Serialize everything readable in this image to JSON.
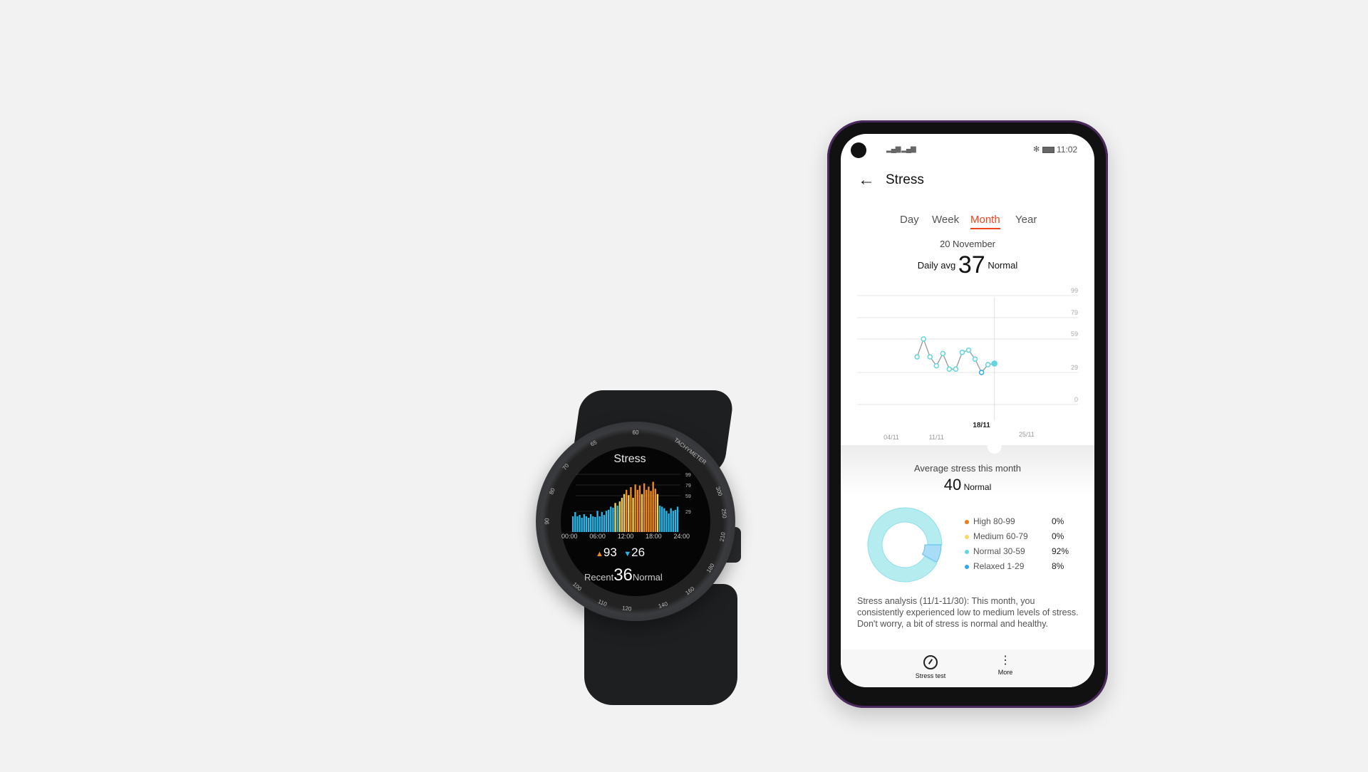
{
  "watch": {
    "title": "Stress",
    "ticks": [
      "99",
      "79",
      "59",
      "29"
    ],
    "time_labels": [
      "00:00",
      "06:00",
      "12:00",
      "18:00",
      "24:00"
    ],
    "max_value": "93",
    "min_value": "26",
    "recent_label": "Recent",
    "recent_value": "36",
    "recent_status": "Normal",
    "bezel_labels": [
      "60",
      "TACHYMETER",
      "300",
      "250",
      "210",
      "180",
      "160",
      "140",
      "120",
      "110",
      "100",
      "90",
      "80",
      "70",
      "65"
    ],
    "colors": {
      "relaxed": "#29b6e8",
      "normal": "#f5d45a",
      "high": "#f08a1c"
    }
  },
  "phone": {
    "status": {
      "signal": "signal-icon",
      "bluetooth": "bluetooth-icon",
      "battery": "battery-icon",
      "time": "11:02"
    },
    "title": "Stress",
    "tabs": [
      {
        "label": "Day"
      },
      {
        "label": "Week"
      },
      {
        "label": "Month",
        "active": true
      },
      {
        "label": "Year"
      }
    ],
    "accent": "#f0421c",
    "date": "20 November",
    "daily_avg_label": "Daily avg",
    "daily_avg_value": "37",
    "daily_avg_status": "Normal",
    "month_avg_label": "Average stress this month",
    "month_avg_value": "40",
    "month_avg_status": "Normal",
    "legend": [
      {
        "label": "High 80-99",
        "pct": "0%",
        "color": "#ef7a1a"
      },
      {
        "label": "Medium 60-79",
        "pct": "0%",
        "color": "#fbd86a"
      },
      {
        "label": "Normal 30-59",
        "pct": "92%",
        "color": "#5fd6e0"
      },
      {
        "label": "Relaxed 1-29",
        "pct": "8%",
        "color": "#2ea8ef"
      }
    ],
    "analysis": "Stress analysis (11/1-11/30): This month, you consistently experienced low to medium levels of stress. Don't worry, a bit of stress is normal and healthy.",
    "bottom": [
      {
        "label": "Stress test",
        "icon": "gauge-icon"
      },
      {
        "label": "More",
        "icon": "more-vertical-icon"
      }
    ]
  },
  "chart_data": [
    {
      "type": "line",
      "x_labels": [
        "04/11",
        "11/11",
        "18/11",
        "25/11"
      ],
      "selected_x": "18/11",
      "y_ticks": [
        99,
        79,
        59,
        29,
        0
      ],
      "x": [
        "08/11",
        "09/11",
        "10/11",
        "11/11",
        "12/11",
        "13/11",
        "14/11",
        "15/11",
        "16/11",
        "17/11",
        "18/11",
        "19/11",
        "20/11"
      ],
      "days": [
        8,
        9,
        10,
        11,
        12,
        13,
        14,
        15,
        16,
        17,
        18,
        19,
        20
      ],
      "values": [
        43,
        59,
        43,
        35,
        46,
        32,
        32,
        47,
        49,
        41,
        29,
        36,
        37
      ],
      "grid": true
    },
    {
      "type": "bar",
      "x_labels": [
        "00:00",
        "06:00",
        "12:00",
        "18:00",
        "24:00"
      ],
      "y_ticks": [
        99,
        79,
        59,
        29
      ],
      "values": [
        22,
        28,
        22,
        24,
        20,
        25,
        22,
        20,
        25,
        22,
        21,
        30,
        22,
        28,
        24,
        30,
        32,
        38,
        36,
        45,
        40,
        48,
        55,
        62,
        70,
        60,
        75,
        55,
        80,
        70,
        78,
        62,
        82,
        70,
        76,
        68,
        85,
        72,
        62,
        40,
        38,
        35,
        30,
        26,
        35,
        30,
        32,
        38
      ]
    }
  ],
  "donut": {
    "normal_pct": 92,
    "relaxed_pct": 8
  }
}
